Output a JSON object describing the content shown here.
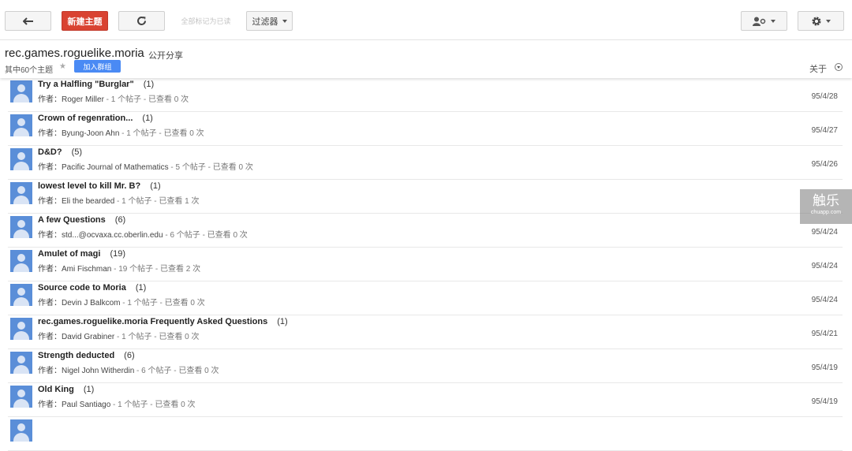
{
  "toolbar": {
    "new_topic_label": "新建主题",
    "mark_read_label": "全部标记为已读",
    "filter_label": "过滤器"
  },
  "group": {
    "name": "rec.games.roguelike.moria",
    "share": "公开分享",
    "topic_count": "其中60个主题",
    "join_label": "加入群组",
    "about_label": "关于"
  },
  "topics": [
    {
      "title": "Try a Halfling \"Burglar\"",
      "count": "(1)",
      "author_prefix": "作者：",
      "author": "Roger Miller",
      "stats": " - 1 个帖子 - 已查看 0 次",
      "date": "95/4/28"
    },
    {
      "title": "Crown of regenration...",
      "count": "(1)",
      "author_prefix": "作者：",
      "author": "Byung-Joon Ahn",
      "stats": " - 1 个帖子 - 已查看 0 次",
      "date": "95/4/27"
    },
    {
      "title": "D&D?",
      "count": "(5)",
      "author_prefix": "作者：",
      "author": "Pacific Journal of Mathematics",
      "stats": " - 5 个帖子 - 已查看 0 次",
      "date": "95/4/26"
    },
    {
      "title": "lowest level to kill Mr. B?",
      "count": "(1)",
      "author_prefix": "作者：",
      "author": "Eli the bearded",
      "stats": " - 1 个帖子 - 已查看 1 次",
      "date": ""
    },
    {
      "title": "A few Questions",
      "count": "(6)",
      "author_prefix": "作者：",
      "author": "std...@ocvaxa.cc.oberlin.edu",
      "stats": " - 6 个帖子 - 已查看 0 次",
      "date": "95/4/24"
    },
    {
      "title": "Amulet of magi",
      "count": "(19)",
      "author_prefix": "作者：",
      "author": "Ami Fischman",
      "stats": " - 19 个帖子 - 已查看 2 次",
      "date": "95/4/24"
    },
    {
      "title": "Source code to Moria",
      "count": "(1)",
      "author_prefix": "作者：",
      "author": "Devin J Balkcom",
      "stats": " - 1 个帖子 - 已查看 0 次",
      "date": "95/4/24"
    },
    {
      "title": "rec.games.roguelike.moria Frequently Asked Questions",
      "count": "(1)",
      "author_prefix": "作者：",
      "author": "David Grabiner",
      "stats": " - 1 个帖子 - 已查看 0 次",
      "date": "95/4/21"
    },
    {
      "title": "Strength deducted",
      "count": "(6)",
      "author_prefix": "作者：",
      "author": "Nigel John Witherdin",
      "stats": " - 6 个帖子 - 已查看 0 次",
      "date": "95/4/19"
    },
    {
      "title": "Old King",
      "count": "(1)",
      "author_prefix": "作者：",
      "author": "Paul Santiago",
      "stats": " - 1 个帖子 - 已查看 0 次",
      "date": "95/4/19"
    },
    {
      "title": "",
      "count": "",
      "author_prefix": "",
      "author": "",
      "stats": "",
      "date": ""
    }
  ],
  "watermark": {
    "main": "触乐",
    "sub": "chuapp.com"
  },
  "icons": {
    "back": "back-arrow-icon",
    "refresh": "refresh-icon",
    "user_settings": "person-gear-icon",
    "settings": "gear-icon",
    "star": "star-icon",
    "about_toggle": "chevron-circle-icon",
    "avatar": "default-avatar-icon"
  },
  "colors": {
    "new_topic": "#d94332",
    "join": "#4a8af4",
    "avatar": "#5a8ed8"
  }
}
